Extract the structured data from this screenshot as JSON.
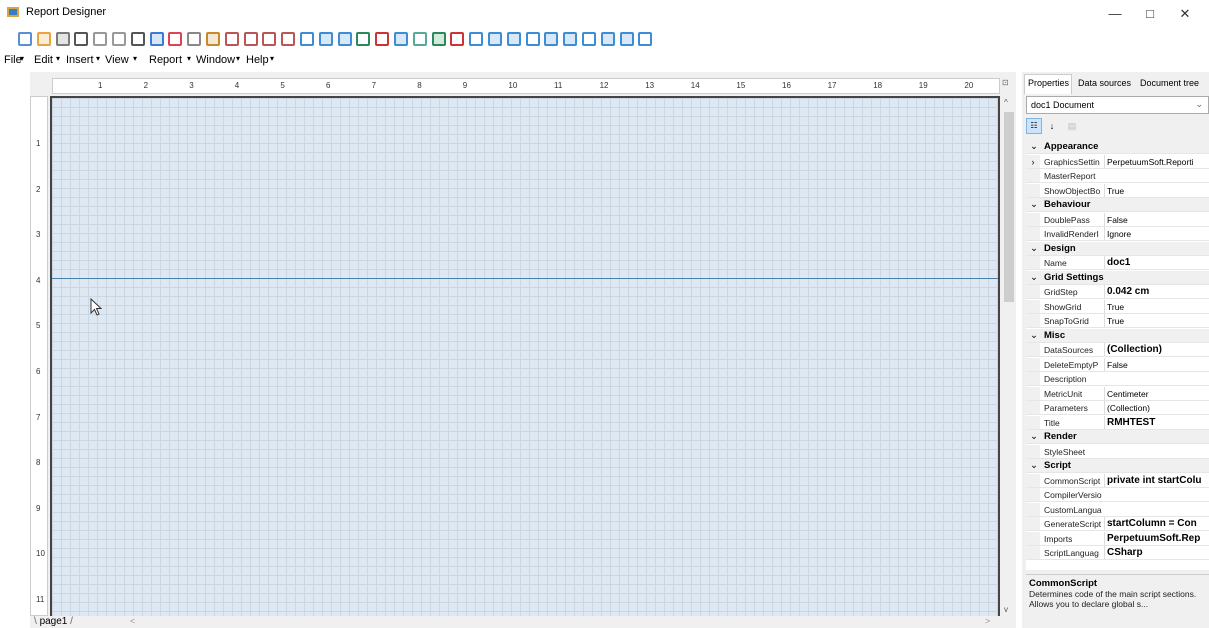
{
  "window": {
    "title": "Report Designer",
    "minimize": "—",
    "maximize": "□",
    "close": "✕"
  },
  "menu": {
    "items": [
      "File",
      "Edit",
      "Insert",
      "View",
      "Report",
      "Window",
      "Help"
    ]
  },
  "ruler": {
    "h": [
      "1",
      "2",
      "3",
      "4",
      "5",
      "6",
      "7",
      "8",
      "9",
      "10",
      "11",
      "12",
      "13",
      "14",
      "15",
      "16",
      "17",
      "18",
      "19",
      "20"
    ],
    "v": [
      "1",
      "2",
      "3",
      "4",
      "5",
      "6",
      "7",
      "8",
      "9",
      "10",
      "11"
    ]
  },
  "tabs": {
    "page": "page1"
  },
  "panel": {
    "tabs": [
      "Properties",
      "Data sources",
      "Document tree"
    ],
    "selector": "doc1 Document",
    "rows": [
      {
        "c": "Appearance"
      },
      {
        "n": "GraphicsSettin",
        "v": "PerpetuumSoft.Reporti",
        "exp": true
      },
      {
        "n": "MasterReport",
        "v": ""
      },
      {
        "n": "ShowObjectBo",
        "v": "True"
      },
      {
        "c": "Behaviour"
      },
      {
        "n": "DoublePass",
        "v": "False"
      },
      {
        "n": "InvalidRenderI",
        "v": "Ignore"
      },
      {
        "c": "Design"
      },
      {
        "n": "Name",
        "v": "doc1",
        "b": true
      },
      {
        "c": "Grid Settings"
      },
      {
        "n": "GridStep",
        "v": "0.042 cm",
        "b": true
      },
      {
        "n": "ShowGrid",
        "v": "True"
      },
      {
        "n": "SnapToGrid",
        "v": "True"
      },
      {
        "c": "Misc"
      },
      {
        "n": "DataSources",
        "v": "(Collection)",
        "b": true
      },
      {
        "n": "DeleteEmptyP",
        "v": "False"
      },
      {
        "n": "Description",
        "v": ""
      },
      {
        "n": "MetricUnit",
        "v": "Centimeter"
      },
      {
        "n": "Parameters",
        "v": "(Collection)"
      },
      {
        "n": "Title",
        "v": "RMHTEST",
        "b": true
      },
      {
        "c": "Render"
      },
      {
        "n": "StyleSheet",
        "v": ""
      },
      {
        "c": "Script"
      },
      {
        "n": "CommonScript",
        "v": "private int startColu",
        "b": true
      },
      {
        "n": "CompilerVersio",
        "v": ""
      },
      {
        "n": "CustomLangua",
        "v": ""
      },
      {
        "n": "GenerateScript",
        "v": "startColumn = Con",
        "b": true
      },
      {
        "n": "Imports",
        "v": "PerpetuumSoft.Rep",
        "b": true
      },
      {
        "n": "ScriptLanguag",
        "v": "CSharp",
        "b": true
      }
    ],
    "desc_title": "CommonScript",
    "desc_text": "Determines code of the main script sections. Allows you to declare global s..."
  }
}
